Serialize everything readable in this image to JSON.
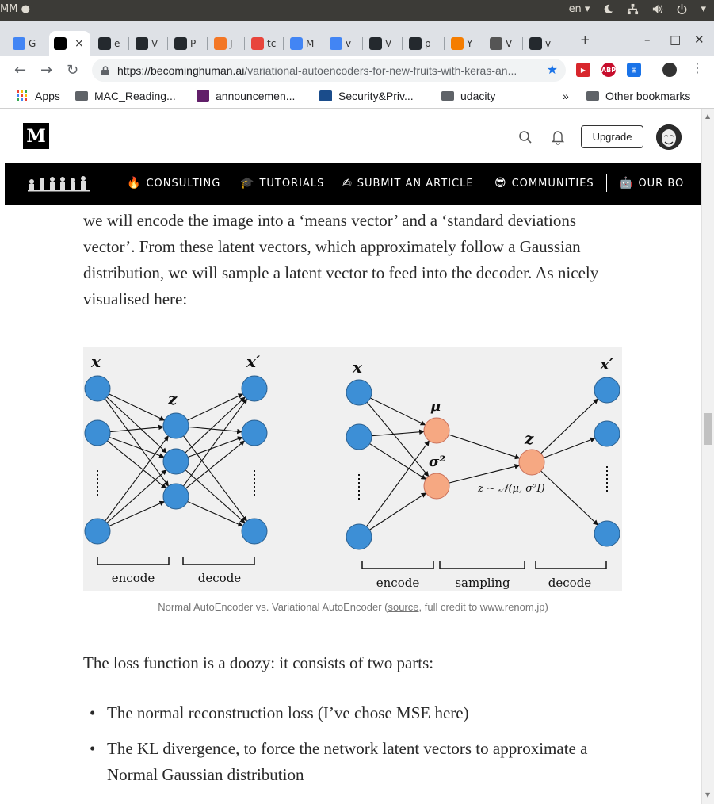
{
  "os": {
    "left_text": "MM ●",
    "language": "en ▾"
  },
  "tabs": [
    {
      "label": "G",
      "fav_color": "#4285f4"
    },
    {
      "label": "",
      "fav_color": "#000000",
      "active": true,
      "close": "×"
    },
    {
      "label": "e",
      "fav_color": "#24292e"
    },
    {
      "label": "V",
      "fav_color": "#24292e"
    },
    {
      "label": "P",
      "fav_color": "#24292e"
    },
    {
      "label": "J",
      "fav_color": "#f37726"
    },
    {
      "label": "tc",
      "fav_color": "#e8453c"
    },
    {
      "label": "M",
      "fav_color": "#4285f4"
    },
    {
      "label": "v",
      "fav_color": "#4285f4"
    },
    {
      "label": "V",
      "fav_color": "#24292e"
    },
    {
      "label": "p",
      "fav_color": "#24292e"
    },
    {
      "label": "Y",
      "fav_color": "#f57d00"
    },
    {
      "label": "V",
      "fav_color": "#555555"
    },
    {
      "label": "v",
      "fav_color": "#24292e"
    }
  ],
  "tabstrip": {
    "new_tab": "+",
    "minimize": "–",
    "maximize": "□",
    "close": "✕"
  },
  "address": {
    "host": "https://becominghuman.ai",
    "path": "/variational-autoencoders-for-new-fruits-with-keras-an..."
  },
  "extensions": [
    "▶",
    "ABP",
    "⊞"
  ],
  "bookmarks": [
    {
      "label": "Apps"
    },
    {
      "label": "MAC_Reading..."
    },
    {
      "label": "announcemen..."
    },
    {
      "label": "Security&Priv..."
    },
    {
      "label": "udacity"
    }
  ],
  "bookmarks_overflow": "»",
  "other_bookmarks": "Other bookmarks",
  "medium": {
    "logo": "M",
    "upgrade": "Upgrade"
  },
  "pubnav": [
    {
      "emoji": "🔥",
      "label": "CONSULTING"
    },
    {
      "emoji": "🎓",
      "label": "TUTORIALS"
    },
    {
      "emoji": "✍",
      "label": "SUBMIT AN ARTICLE"
    },
    {
      "emoji": "😎",
      "label": "COMMUNITIES"
    },
    {
      "emoji": "🤖",
      "label": "OUR BO"
    }
  ],
  "article": {
    "para1": "we will encode the image into a ‘means vector’ and a ‘standard deviations vector’. From these latent vectors, which approximately follow a Gaussian distribution, we will sample a latent vector to feed into the decoder. As nicely visualised here:",
    "caption_pre": "Normal AutoEncoder vs. Variational AutoEncoder (",
    "caption_link": "source",
    "caption_post": ", full credit to www.renom.jp)",
    "para2": "The loss function is a doozy: it consists of two parts:",
    "bullets": [
      "The normal reconstruction loss (I’ve chose MSE here)",
      "The KL divergence, to force the network latent vectors to approximate a Normal Gaussian distribution"
    ]
  },
  "figure": {
    "ae": {
      "x_label": "x",
      "z_label": "z",
      "xp_label": "x′",
      "encode": "encode",
      "decode": "decode"
    },
    "vae": {
      "x_label": "x",
      "mu_label": "μ",
      "sigma_label": "σ²",
      "z_label": "z",
      "xp_label": "x′",
      "sample_eq": "z ∼ 𝒩(μ, σ²I)",
      "encode": "encode",
      "sampling": "sampling",
      "decode": "decode"
    },
    "colors": {
      "blue": "#3d8fd6",
      "orange": "#f6a882",
      "bg": "#f0f0f0"
    }
  }
}
